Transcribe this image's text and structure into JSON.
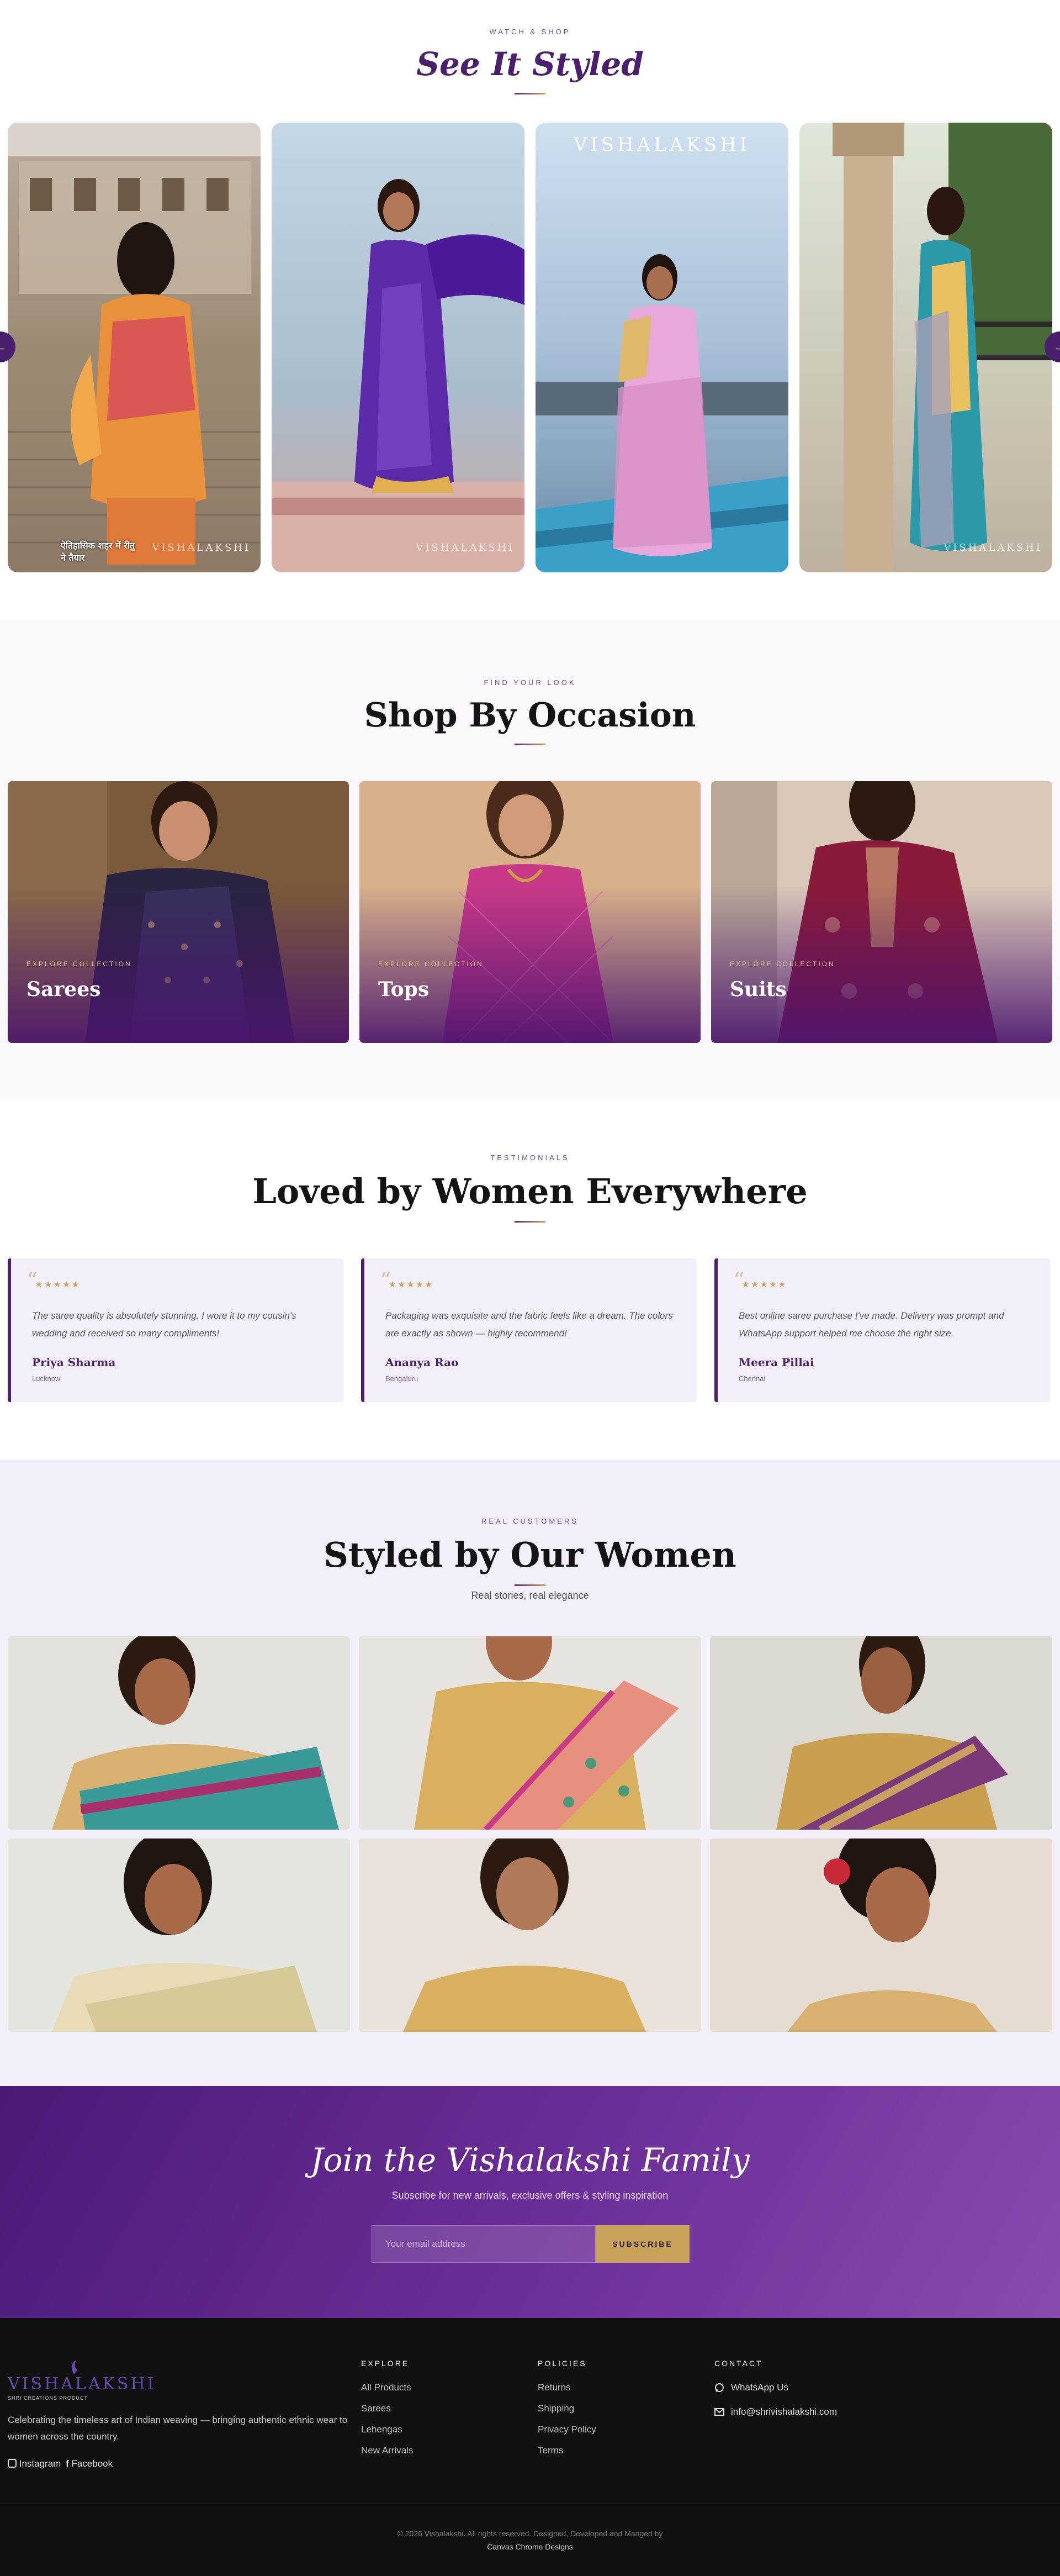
{
  "see_it_styled": {
    "eyebrow": "WATCH & SHOP",
    "title": "See It Styled",
    "videos": [
      {
        "overlay_text": "ऐतिहासिक शहर में रीतु\nने तैयार",
        "brand": "VISHALAKSHI"
      },
      {
        "brand": "VISHALAKSHI"
      },
      {
        "brand_top": "VISHALAKSHI",
        "brand": ""
      },
      {
        "brand": "VISHALAKSHI"
      }
    ],
    "prev_arrow": "←",
    "next_arrow": "→"
  },
  "occasion": {
    "eyebrow": "FIND YOUR LOOK",
    "title": "Shop By Occasion",
    "cards": [
      {
        "eyebrow": "EXPLORE COLLECTION",
        "name": "Sarees"
      },
      {
        "eyebrow": "EXPLORE COLLECTION",
        "name": "Tops"
      },
      {
        "eyebrow": "EXPLORE COLLECTION",
        "name": "Suits"
      }
    ]
  },
  "testimonials": {
    "eyebrow": "TESTIMONIALS",
    "title": "Loved by Women Everywhere",
    "items": [
      {
        "stars": "★★★★★",
        "text": "The saree quality is absolutely stunning. I wore it to my cousin's wedding and received so many compliments!",
        "author": "Priya Sharma",
        "city": "Lucknow"
      },
      {
        "stars": "★★★★★",
        "text": "Packaging was exquisite and the fabric feels like a dream. The colors are exactly as shown — highly recommend!",
        "author": "Ananya Rao",
        "city": "Bengaluru"
      },
      {
        "stars": "★★★★★",
        "text": "Best online saree purchase I've made. Delivery was prompt and WhatsApp support helped me choose the right size.",
        "author": "Meera Pillai",
        "city": "Chennai"
      }
    ]
  },
  "gallery": {
    "eyebrow": "REAL CUSTOMERS",
    "title": "Styled by Our Women",
    "subtitle": "Real stories, real elegance"
  },
  "newsletter": {
    "title": "Join the Vishalakshi Family",
    "subtitle": "Subscribe for new arrivals, exclusive offers & styling inspiration",
    "placeholder": "Your email address",
    "button": "SUBSCRIBE"
  },
  "footer": {
    "logo": "VISHALAKSHI",
    "logo_sub": "SHRI CREATIONS PRODUCT",
    "description": "Celebrating the timeless art of Indian weaving — bringing authentic ethnic wear to women across the country.",
    "social": [
      "Instagram",
      "Facebook"
    ],
    "explore": {
      "title": "EXPLORE",
      "links": [
        "All Products",
        "Sarees",
        "Lehengas",
        "New Arrivals"
      ]
    },
    "policies": {
      "title": "POLICIES",
      "links": [
        "Returns",
        "Shipping",
        "Privacy Policy",
        "Terms"
      ]
    },
    "contact": {
      "title": "CONTACT",
      "whatsapp": "WhatsApp Us",
      "email": "info@shrivishalakshi.com"
    },
    "copyright": "© 2026 Vishalakshi. All rights reserved. Designed, Developed and Manged by",
    "credit": "Canvas Chrome Designs"
  },
  "colors": {
    "brand": "#4a1f6b",
    "gold": "#c9a25a",
    "footer_bg": "#111111"
  }
}
